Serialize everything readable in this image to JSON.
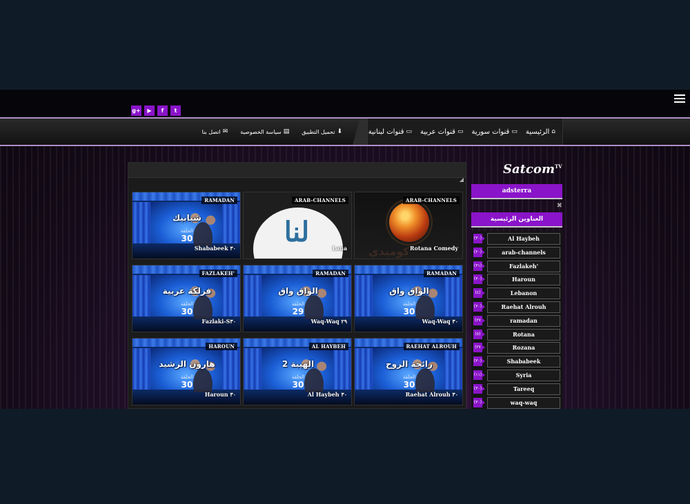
{
  "nav": {
    "main": [
      {
        "label": "الرئيسية",
        "icon": "home-icon"
      },
      {
        "label": "قنوات سورية",
        "icon": "tv-icon"
      },
      {
        "label": "قنوات عربية",
        "icon": "tv-icon"
      },
      {
        "label": "قنوات لبنانية",
        "icon": "tv-icon"
      }
    ],
    "secondary": [
      {
        "label": "تحميل التطبيق",
        "icon": "download-icon"
      },
      {
        "label": "سياسة الخصوصية",
        "icon": "file-icon"
      },
      {
        "label": "اتصل بنا",
        "icon": "mail-icon"
      }
    ]
  },
  "social": {
    "googleplus": "g+",
    "youtube": "▶",
    "facebook": "f",
    "twitter": "t"
  },
  "sidebar": {
    "logo": "Satcom",
    "logo_sup": "TV",
    "ad_label": "adsterra",
    "labels_title": "العناوين الرئيسية",
    "labels": [
      {
        "name": "Al Haybeh",
        "count": "(٣٠)"
      },
      {
        "name": "arab-channels",
        "count": "(٢٠)"
      },
      {
        "name": "Fazlakeh'",
        "count": "(٣١)"
      },
      {
        "name": "Haroun",
        "count": "(٣٠)"
      },
      {
        "name": "Lebanon",
        "count": "(٤)"
      },
      {
        "name": "Raehat Alrouh",
        "count": "(٣٠)"
      },
      {
        "name": "ramadan",
        "count": "(٢٧"
      },
      {
        "name": "Rotana",
        "count": "(٥)"
      },
      {
        "name": "Rozana",
        "count": "(٢٧"
      },
      {
        "name": "Shababeek",
        "count": "(٣٠)"
      },
      {
        "name": "Syria",
        "count": "(١١)"
      },
      {
        "name": "Tareeq",
        "count": "(٣٠)"
      },
      {
        "name": "waq-waq",
        "count": "(٣٠)"
      }
    ]
  },
  "posts": [
    {
      "badge": "RAMADAN",
      "title": "Shababeek ٣٠",
      "thumb": "ramadan",
      "thumb_title": "شبابيك",
      "thumb_ep": "الحلقة",
      "thumb_num": "30"
    },
    {
      "badge": "ARAB-CHANNELS",
      "title": "Lana",
      "thumb": "lana",
      "thumb_logo": "لنا"
    },
    {
      "badge": "ARAB-CHANNELS",
      "title": "Rotana Comedy",
      "thumb": "rotana",
      "thumb_text": "كوميدي"
    },
    {
      "badge": "FAZLAKEH'",
      "title": "Fazlaki-S٣٠",
      "thumb": "ramadan",
      "thumb_title": "فزلكة عربية",
      "thumb_ep": "الحلقة",
      "thumb_num": "30"
    },
    {
      "badge": "RAMADAN",
      "title": "Waq-Waq ٢٩",
      "thumb": "ramadan",
      "thumb_title": "الواق واق",
      "thumb_ep": "الحلقة",
      "thumb_num": "29"
    },
    {
      "badge": "RAMADAN",
      "title": "Waq-Waq ٣٠",
      "thumb": "ramadan",
      "thumb_title": "الواق واق",
      "thumb_ep": "الحلقة",
      "thumb_num": "30"
    },
    {
      "badge": "HAROUN",
      "title": "Haroun ٣٠",
      "thumb": "ramadan",
      "thumb_title": "هارون الرشيد",
      "thumb_ep": "الحلقة",
      "thumb_num": "30"
    },
    {
      "badge": "AL HAYBEH",
      "title": "Al Haybeh ٣٠",
      "thumb": "ramadan",
      "thumb_title": "الهيبة 2",
      "thumb_ep": "الحلقة",
      "thumb_num": "30"
    },
    {
      "badge": "RAEHAT ALROUH",
      "title": "Raehat Alrouh ٣٠",
      "thumb": "ramadan",
      "thumb_title": "رائحة الروح",
      "thumb_ep": "الحلقة",
      "thumb_num": "30"
    }
  ]
}
